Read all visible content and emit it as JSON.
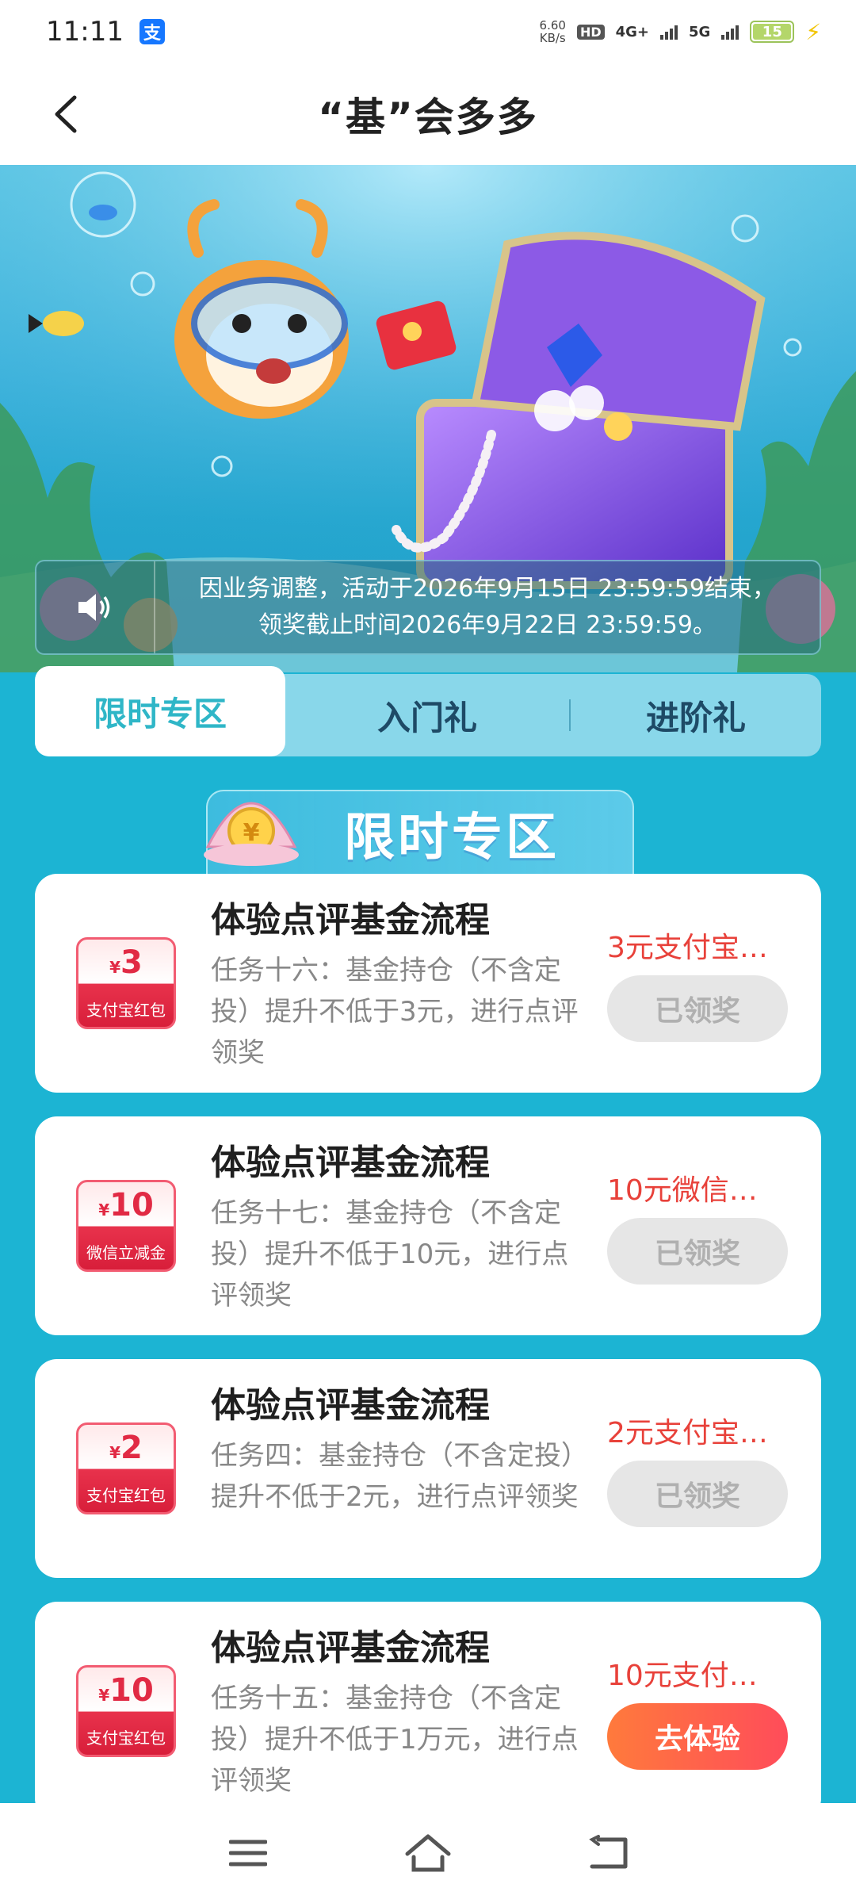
{
  "status_bar": {
    "time": "11:11",
    "net_speed_value": "6.60",
    "net_speed_unit": "KB/s",
    "hd": "HD",
    "sim1": "4G+",
    "sim2": "5G",
    "battery": "15"
  },
  "header": {
    "title": "“基”会多多"
  },
  "notice": {
    "line1": "因业务调整，活动于2026年9月15日 23:59:59结束，",
    "line2": "领奖截止时间2026年9月22日 23:59:59。"
  },
  "tabs": [
    {
      "label": "限时专区",
      "active": true
    },
    {
      "label": "入门礼",
      "active": false
    },
    {
      "label": "进阶礼",
      "active": false
    }
  ],
  "section": {
    "title": "限时专区"
  },
  "tasks": [
    {
      "coupon_amount": "3",
      "coupon_currency": "¥",
      "coupon_label": "支付宝红包",
      "title": "体验点评基金流程",
      "desc": "任务十六：基金持仓（不含定投）提升不低于3元，进行点评领奖",
      "reward": "3元支付宝…",
      "button": "已领奖",
      "button_state": "done"
    },
    {
      "coupon_amount": "10",
      "coupon_currency": "¥",
      "coupon_label": "微信立减金",
      "title": "体验点评基金流程",
      "desc": "任务十七：基金持仓（不含定投）提升不低于10元，进行点评领奖",
      "reward": "10元微信…",
      "button": "已领奖",
      "button_state": "done"
    },
    {
      "coupon_amount": "2",
      "coupon_currency": "¥",
      "coupon_label": "支付宝红包",
      "title": "体验点评基金流程",
      "desc": "任务四：基金持仓（不含定投）提升不低于2元，进行点评领奖",
      "reward": "2元支付宝…",
      "button": "已领奖",
      "button_state": "done"
    },
    {
      "coupon_amount": "10",
      "coupon_currency": "¥",
      "coupon_label": "支付宝红包",
      "title": "体验点评基金流程",
      "desc": "任务十五：基金持仓（不含定投）提升不低于1万元，进行点评领奖",
      "reward": "10元支付…",
      "button": "去体验",
      "button_state": "active"
    }
  ],
  "colors": {
    "page_bg": "#1cb4d3",
    "reward_text": "#e8413a",
    "active_tab_text": "#2fb6c7",
    "go_button": "#ff5a4a"
  }
}
